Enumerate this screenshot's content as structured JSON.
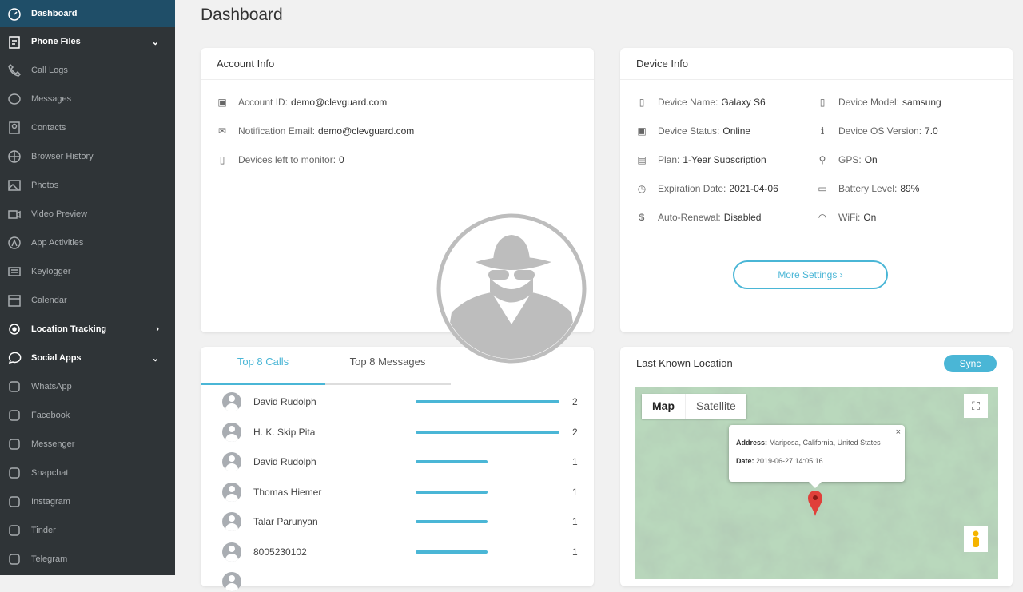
{
  "sidebar": {
    "items": [
      {
        "label": "Dashboard",
        "icon": "gauge-icon",
        "state": "active"
      },
      {
        "label": "Phone Files",
        "icon": "clipboard-icon",
        "state": "bold",
        "chevron": "⌄"
      },
      {
        "label": "Call Logs",
        "icon": "phone-icon"
      },
      {
        "label": "Messages",
        "icon": "chat-icon"
      },
      {
        "label": "Contacts",
        "icon": "contact-icon"
      },
      {
        "label": "Browser History",
        "icon": "globe-icon"
      },
      {
        "label": "Photos",
        "icon": "image-icon"
      },
      {
        "label": "Video Preview",
        "icon": "video-icon"
      },
      {
        "label": "App Activities",
        "icon": "app-store-icon"
      },
      {
        "label": "Keylogger",
        "icon": "keyboard-icon"
      },
      {
        "label": "Calendar",
        "icon": "calendar-icon"
      },
      {
        "label": "Location Tracking",
        "icon": "target-icon",
        "state": "bold",
        "chevron": "›"
      },
      {
        "label": "Social Apps",
        "icon": "chat-bubble-icon",
        "state": "bold",
        "chevron": "⌄"
      },
      {
        "label": "WhatsApp",
        "icon": "whatsapp-icon"
      },
      {
        "label": "Facebook",
        "icon": "facebook-icon"
      },
      {
        "label": "Messenger",
        "icon": "messenger-icon"
      },
      {
        "label": "Snapchat",
        "icon": "snapchat-icon"
      },
      {
        "label": "Instagram",
        "icon": "instagram-icon"
      },
      {
        "label": "Tinder",
        "icon": "tinder-icon"
      },
      {
        "label": "Telegram",
        "icon": "telegram-icon"
      }
    ]
  },
  "page": {
    "title": "Dashboard"
  },
  "account": {
    "title": "Account Info",
    "rows": [
      {
        "label": "Account ID:",
        "value": "demo@clevguard.com"
      },
      {
        "label": "Notification Email:",
        "value": "demo@clevguard.com"
      },
      {
        "label": "Devices left to monitor:",
        "value": "0"
      }
    ]
  },
  "device": {
    "title": "Device Info",
    "left": [
      {
        "label": "Device Name:",
        "value": "Galaxy S6",
        "icon": "▯"
      },
      {
        "label": "Device Status:",
        "value": "Online",
        "icon": "▣"
      },
      {
        "label": "Plan:",
        "value": "1-Year Subscription",
        "icon": "▤"
      },
      {
        "label": "Expiration Date:",
        "value": "2021-04-06",
        "icon": "◷"
      },
      {
        "label": "Auto-Renewal:",
        "value": "Disabled",
        "icon": "$"
      }
    ],
    "right": [
      {
        "label": "Device Model:",
        "value": "samsung",
        "icon": "▯"
      },
      {
        "label": "Device OS Version:",
        "value": "7.0",
        "icon": "ℹ"
      },
      {
        "label": "GPS:",
        "value": "On",
        "icon": "⚲"
      },
      {
        "label": "Battery Level:",
        "value": "89%",
        "icon": "▭"
      },
      {
        "label": "WiFi:",
        "value": "On",
        "icon": "◠"
      }
    ],
    "more": "More Settings ›"
  },
  "top": {
    "tabs": [
      "Top 8 Calls",
      "Top 8 Messages"
    ],
    "calls": [
      {
        "name": "David Rudolph",
        "count": 2
      },
      {
        "name": "H. K. Skip Pita",
        "count": 2
      },
      {
        "name": "David Rudolph",
        "count": 1
      },
      {
        "name": "Thomas Hiemer",
        "count": 1
      },
      {
        "name": "Talar Parunyan",
        "count": 1
      },
      {
        "name": "8005230102",
        "count": 1
      }
    ],
    "max": 2
  },
  "location": {
    "title": "Last Known Location",
    "sync": "Sync",
    "map_tab": "Map",
    "satellite_tab": "Satellite",
    "address_label": "Address:",
    "address": "Mariposa, California, United States",
    "date_label": "Date:",
    "date": "2019-06-27 14:05:16",
    "close": "×",
    "fullscreen": "⛶"
  },
  "colors": {
    "accent": "#4ab6d6",
    "sidebar": "#2f3437",
    "active": "#1f4e68"
  }
}
